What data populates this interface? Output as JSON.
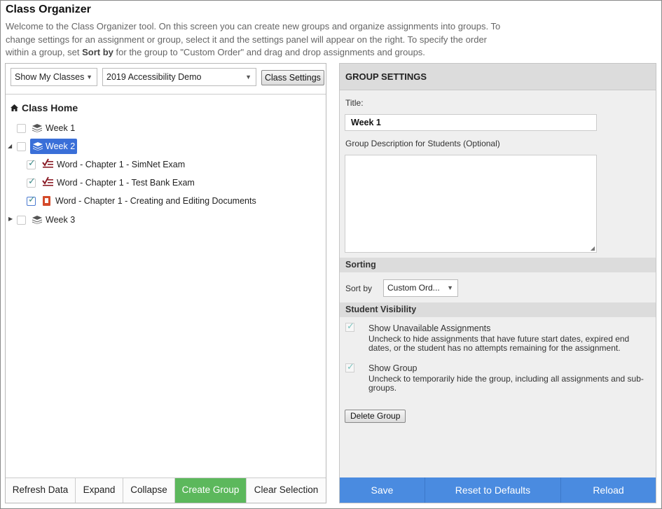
{
  "app": {
    "title": "Class Organizer",
    "intro_part1": "Welcome to the Class Organizer tool. On this screen you can create new groups and organize assignments into groups. To change settings for an assignment or group, select it and the settings panel will appear on the right. To specify the order within a group, set ",
    "intro_bold": "Sort by",
    "intro_part2": " for the group to \"Custom Order\" and drag and drop assignments and groups."
  },
  "toolbar": {
    "classes_filter": "Show My Classes",
    "class_select": "2019 Accessibility Demo",
    "class_settings_label": "Class Settings"
  },
  "tree": {
    "home_label": "Class Home",
    "groups": [
      {
        "label": "Week 1",
        "checked": false
      },
      {
        "label": "Week 2",
        "checked": false,
        "selected": true,
        "expanded": true
      },
      {
        "label": "Week 3",
        "checked": false
      }
    ],
    "assignments": [
      {
        "label": "Word - Chapter 1 - SimNet Exam",
        "icon": "exam-icon",
        "checked": true
      },
      {
        "label": "Word - Chapter 1 - Test Bank Exam",
        "icon": "exam-icon",
        "checked": true
      },
      {
        "label": "Word - Chapter 1 - Creating and Editing Documents",
        "icon": "document-icon",
        "checked": true
      }
    ]
  },
  "bottom_actions": {
    "refresh": "Refresh Data",
    "expand": "Expand",
    "collapse": "Collapse",
    "create_group": "Create Group",
    "clear_selection": "Clear Selection"
  },
  "group_settings": {
    "header": "GROUP SETTINGS",
    "title_label": "Title:",
    "title_value": "Week 1",
    "description_label": "Group Description for Students (Optional)",
    "description_value": "",
    "sorting_header": "Sorting",
    "sort_by_label": "Sort by",
    "sort_by_value": "Custom Ord...",
    "visibility_header": "Student Visibility",
    "show_unavailable_label": "Show Unavailable Assignments",
    "show_unavailable_help": "Uncheck to hide assignments that have future start dates, expired end dates, or the student has no attempts remaining for the assignment.",
    "show_unavailable_checked": true,
    "show_group_label": "Show Group",
    "show_group_help": "Uncheck to temporarily hide the group, including all assignments and sub-groups.",
    "show_group_checked": true,
    "delete_group_label": "Delete Group"
  },
  "settings_actions": {
    "save": "Save",
    "reset": "Reset to Defaults",
    "reload": "Reload"
  },
  "colors": {
    "selection_blue": "#3a6fd8",
    "create_green": "#5cb85c",
    "action_blue": "#4a8be0"
  }
}
